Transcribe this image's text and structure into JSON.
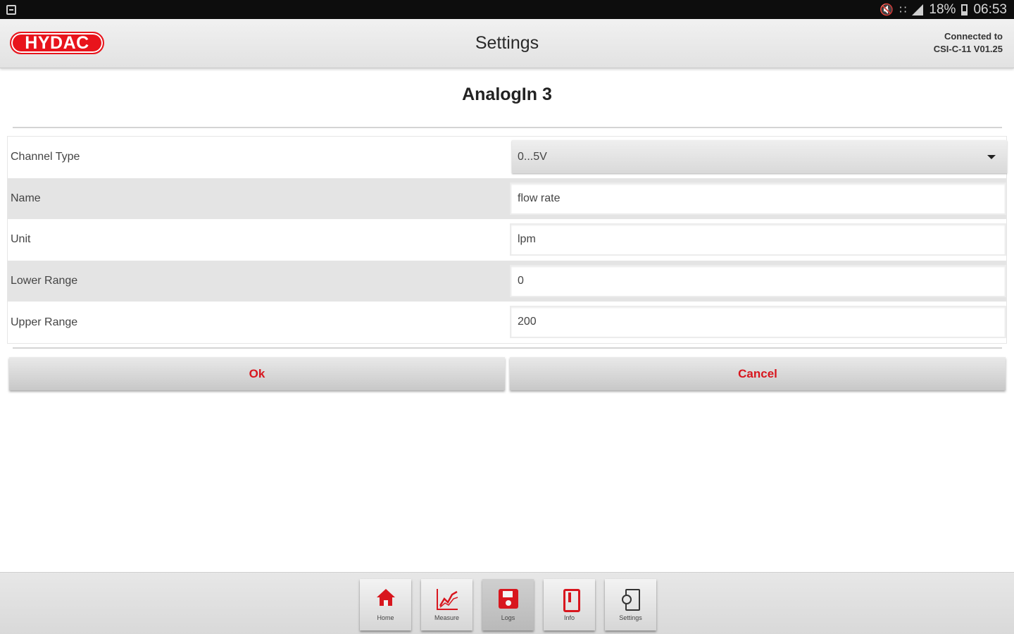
{
  "status_bar": {
    "battery": "18%",
    "time": "06:53",
    "icons": [
      "notification-icon",
      "mute-icon",
      "wifi-icon",
      "signal-icon",
      "battery-icon"
    ]
  },
  "header": {
    "logo_text": "HYDAC",
    "title": "Settings",
    "connection_line1": "Connected to",
    "connection_line2": "CSI-C-11 V01.25"
  },
  "page": {
    "title": "AnalogIn 3"
  },
  "form": {
    "rows": [
      {
        "label": "Channel Type",
        "value": "0...5V",
        "kind": "select"
      },
      {
        "label": "Name",
        "value": "flow rate",
        "kind": "input"
      },
      {
        "label": "Unit",
        "value": "lpm",
        "kind": "input"
      },
      {
        "label": "Lower Range",
        "value": "0",
        "kind": "input"
      },
      {
        "label": "Upper Range",
        "value": "200",
        "kind": "input"
      }
    ]
  },
  "buttons": {
    "ok": "Ok",
    "cancel": "Cancel"
  },
  "bottom_nav": {
    "items": [
      {
        "label": "Home",
        "icon": "home-icon"
      },
      {
        "label": "Measure",
        "icon": "chart-icon"
      },
      {
        "label": "Logs",
        "icon": "save-icon"
      },
      {
        "label": "Info",
        "icon": "info-icon"
      },
      {
        "label": "Settings",
        "icon": "settings-icon"
      }
    ],
    "active": "Logs"
  },
  "colors": {
    "accent": "#d8161e",
    "header_bg": "#e8e8e8",
    "alt_row": "#e4e4e4"
  }
}
